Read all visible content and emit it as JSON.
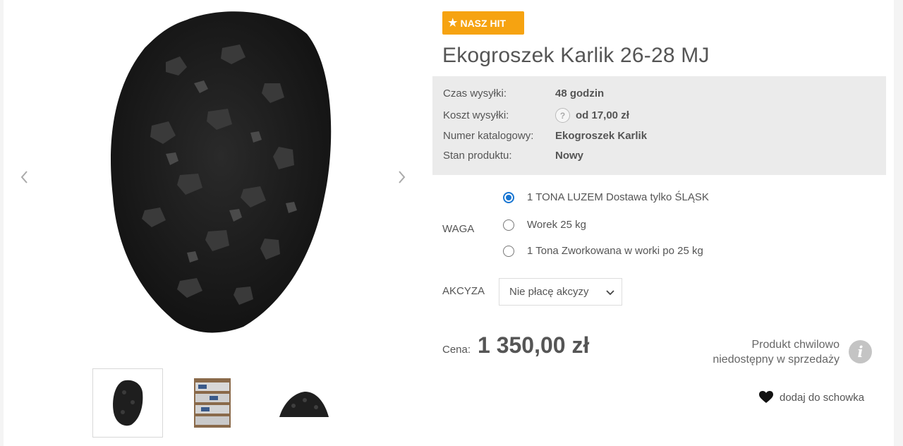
{
  "badge": {
    "icon": "star-icon",
    "label": "NASZ HIT",
    "color": "#f6a311"
  },
  "product": {
    "title": "Ekogroszek Karlik 26-28 MJ"
  },
  "details": {
    "shipping_time_label": "Czas wysyłki:",
    "shipping_time_value": "48 godzin",
    "shipping_cost_label": "Koszt wysyłki:",
    "shipping_cost_value": "od 17,00 zł",
    "catalog_label": "Numer katalogowy:",
    "catalog_value": "Ekogroszek Karlik",
    "condition_label": "Stan produktu:",
    "condition_value": "Nowy",
    "help_icon": "?"
  },
  "weight": {
    "label": "WAGA",
    "options": [
      {
        "label": "1 TONA LUZEM Dostawa tylko ŚLĄSK",
        "selected": true
      },
      {
        "label": "Worek 25 kg",
        "selected": false
      },
      {
        "label": "1 Tona Zworkowana w worki po 25 kg",
        "selected": false
      }
    ]
  },
  "excise": {
    "label": "AKCYZA",
    "selected": "Nie płacę akcyzy"
  },
  "price": {
    "label": "Cena:",
    "value": "1 350,00 zł"
  },
  "availability": {
    "line1": "Produkt chwilowo",
    "line2": "niedostępny w sprzedaży",
    "icon": "i"
  },
  "wishlist": {
    "label": "dodaj do schowka",
    "icon": "heart-icon"
  },
  "gallery": {
    "thumbnail_count": 3,
    "active_thumbnail": 1
  },
  "colors": {
    "accent": "#f6a311",
    "radio": "#1976d2",
    "details_bg": "#ebebeb"
  }
}
